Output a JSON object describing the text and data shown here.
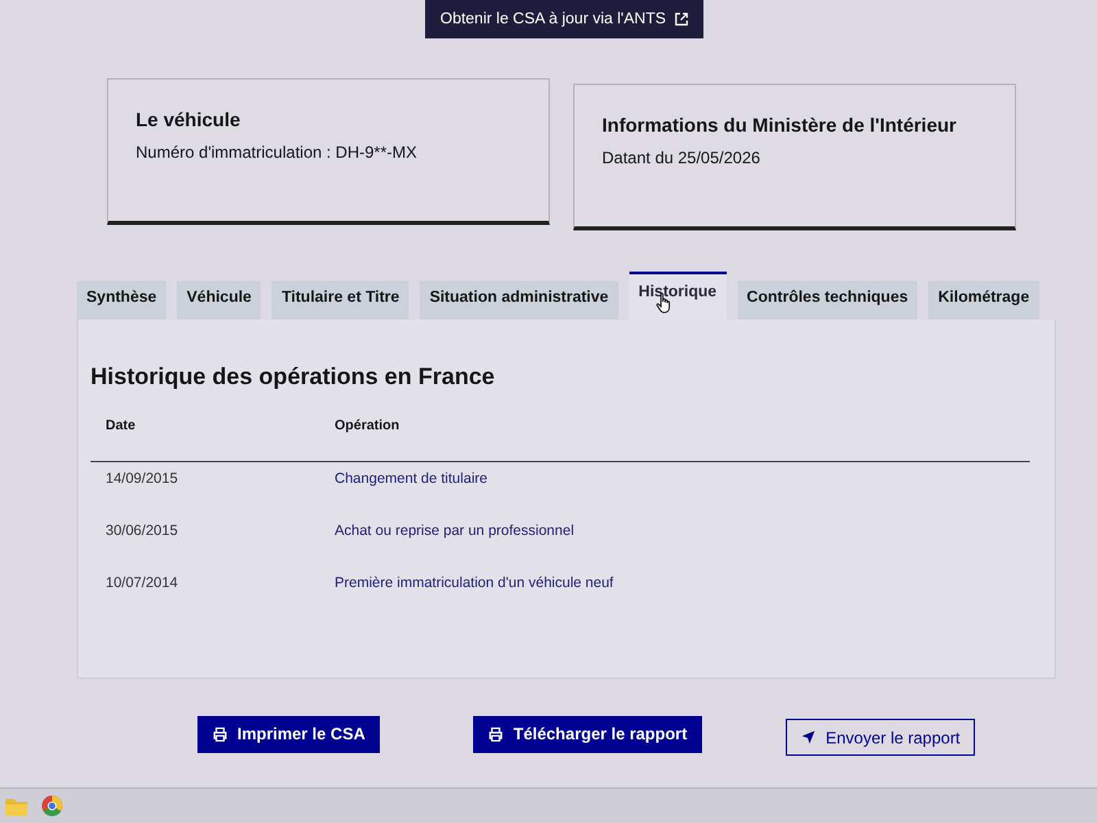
{
  "top_button": {
    "label": "Obtenir le CSA à jour via l'ANTS"
  },
  "cards": [
    {
      "title": "Le véhicule",
      "text": "Numéro d'immatriculation : DH-9**-MX"
    },
    {
      "title": "Informations du Ministère de l'Intérieur",
      "text": "Datant du 25/05/2026"
    }
  ],
  "tabs": [
    {
      "label": "Synthèse",
      "selected": false
    },
    {
      "label": "Véhicule",
      "selected": false
    },
    {
      "label": "Titulaire et Titre",
      "selected": false
    },
    {
      "label": "Situation administrative",
      "selected": false
    },
    {
      "label": "Historique",
      "selected": true
    },
    {
      "label": "Contrôles techniques",
      "selected": false
    },
    {
      "label": "Kilométrage",
      "selected": false
    }
  ],
  "panel": {
    "title": "Historique des opérations en France",
    "table": {
      "columns": [
        "Date",
        "Opération"
      ],
      "rows": [
        [
          "14/09/2015",
          "Changement de titulaire"
        ],
        [
          "30/06/2015",
          "Achat ou reprise par un professionnel"
        ],
        [
          "10/07/2014",
          "Première immatriculation d'un véhicule neuf"
        ]
      ]
    }
  },
  "buttons": [
    {
      "label": "Imprimer le CSA",
      "kind": "primary"
    },
    {
      "label": "Télécharger le rapport",
      "kind": "primary"
    },
    {
      "label": "Envoyer le rapport",
      "kind": "secondary"
    }
  ]
}
